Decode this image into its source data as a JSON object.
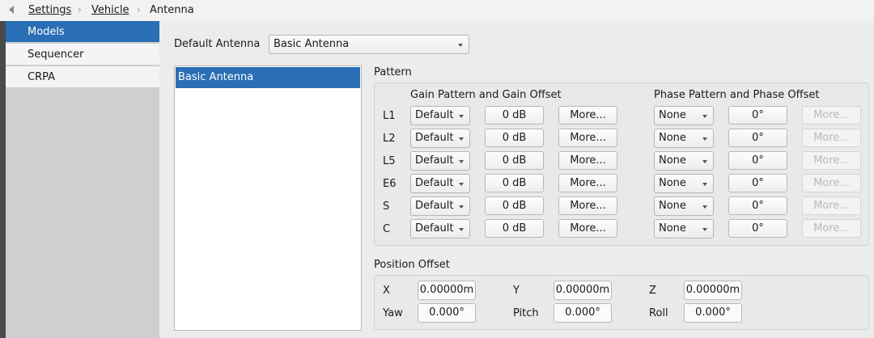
{
  "breadcrumb": {
    "items": [
      "Settings",
      "Vehicle",
      "Antenna"
    ]
  },
  "sidebar": {
    "items": [
      {
        "label": "Models",
        "active": true
      },
      {
        "label": "Sequencer",
        "active": false
      },
      {
        "label": "CRPA",
        "active": false
      }
    ]
  },
  "default_antenna": {
    "label": "Default Antenna",
    "value": "Basic Antenna"
  },
  "antenna_list": {
    "items": [
      "Basic Antenna"
    ]
  },
  "pattern": {
    "title": "Pattern",
    "gain_header": "Gain Pattern and Gain Offset",
    "phase_header": "Phase Pattern and Phase Offset",
    "rows": [
      {
        "band": "L1",
        "gain_pattern": "Default",
        "gain_offset": "0 dB",
        "gain_more": "More...",
        "phase_pattern": "None",
        "phase_offset": "0°",
        "phase_more": "More..."
      },
      {
        "band": "L2",
        "gain_pattern": "Default",
        "gain_offset": "0 dB",
        "gain_more": "More...",
        "phase_pattern": "None",
        "phase_offset": "0°",
        "phase_more": "More..."
      },
      {
        "band": "L5",
        "gain_pattern": "Default",
        "gain_offset": "0 dB",
        "gain_more": "More...",
        "phase_pattern": "None",
        "phase_offset": "0°",
        "phase_more": "More..."
      },
      {
        "band": "E6",
        "gain_pattern": "Default",
        "gain_offset": "0 dB",
        "gain_more": "More...",
        "phase_pattern": "None",
        "phase_offset": "0°",
        "phase_more": "More..."
      },
      {
        "band": "S",
        "gain_pattern": "Default",
        "gain_offset": "0 dB",
        "gain_more": "More...",
        "phase_pattern": "None",
        "phase_offset": "0°",
        "phase_more": "More..."
      },
      {
        "band": "C",
        "gain_pattern": "Default",
        "gain_offset": "0 dB",
        "gain_more": "More...",
        "phase_pattern": "None",
        "phase_offset": "0°",
        "phase_more": "More..."
      }
    ]
  },
  "position_offset": {
    "title": "Position Offset",
    "x_label": "X",
    "x_value": "0.00000m",
    "y_label": "Y",
    "y_value": "0.00000m",
    "z_label": "Z",
    "z_value": "0.00000m",
    "yaw_label": "Yaw",
    "yaw_value": "0.000°",
    "pitch_label": "Pitch",
    "pitch_value": "0.000°",
    "roll_label": "Roll",
    "roll_value": "0.000°"
  }
}
